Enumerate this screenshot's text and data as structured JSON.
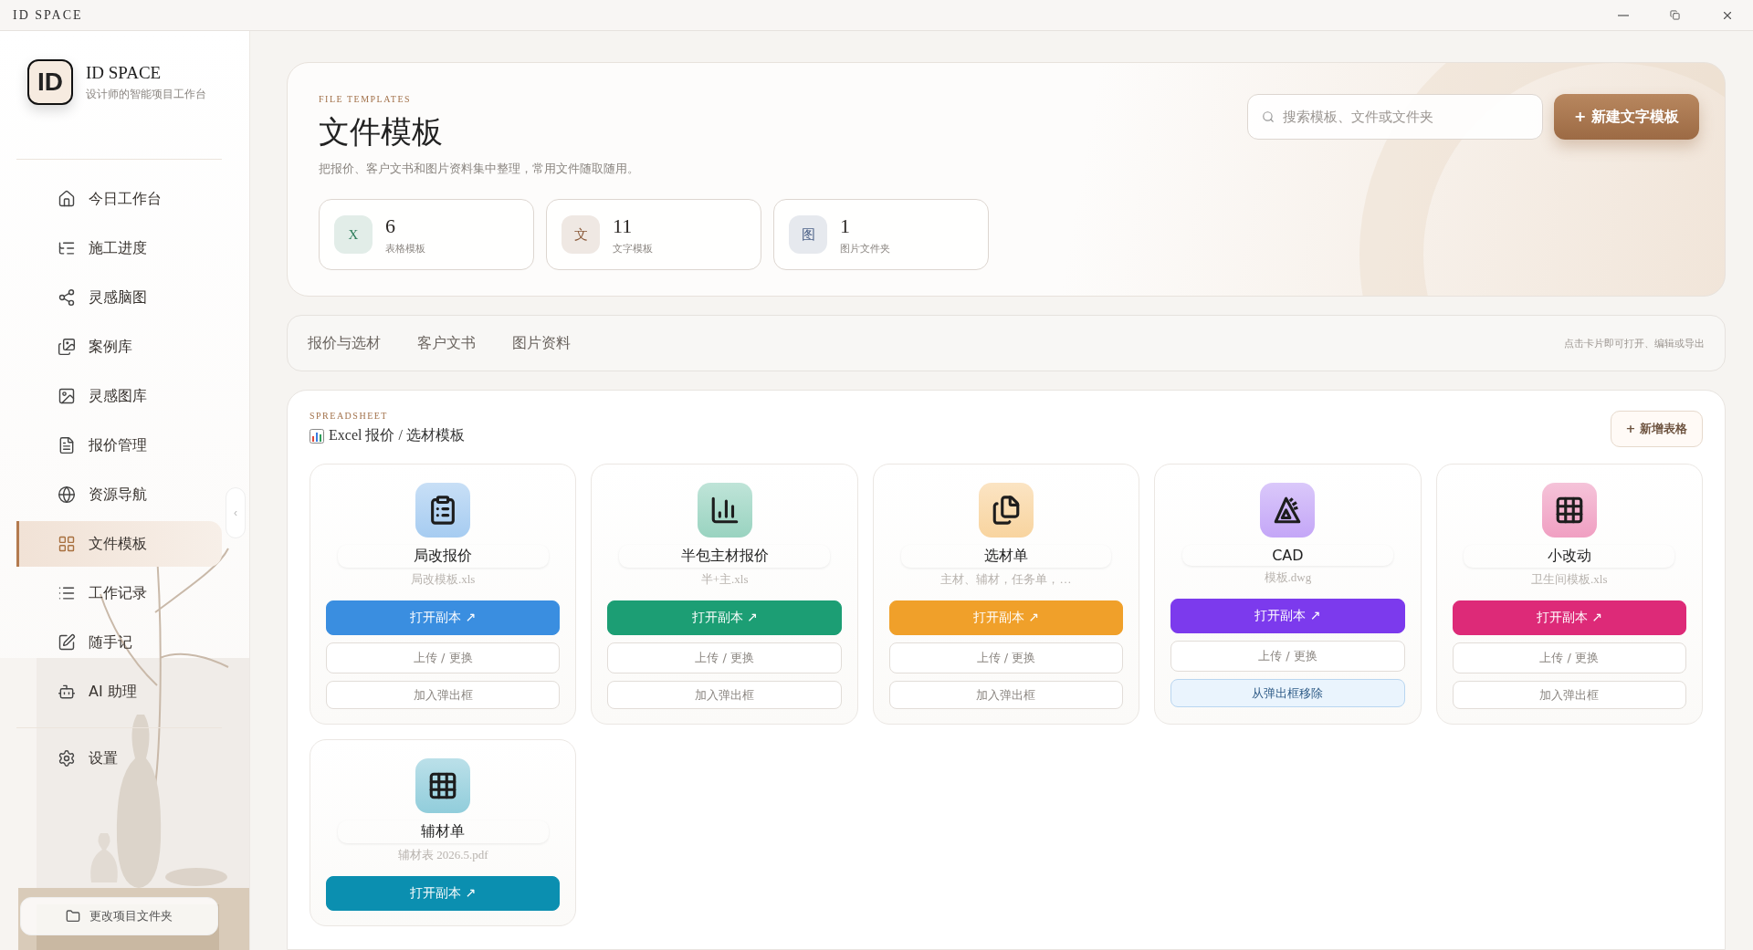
{
  "window": {
    "title": "ID SPACE"
  },
  "sidebar": {
    "brand": {
      "logo": "ID",
      "name": "ID SPACE",
      "tagline": "设计师的智能项目工作台"
    },
    "items": [
      {
        "label": "今日工作台",
        "selected": false
      },
      {
        "label": "施工进度",
        "selected": false
      },
      {
        "label": "灵感脑图",
        "selected": false
      },
      {
        "label": "案例库",
        "selected": false
      },
      {
        "label": "灵感图库",
        "selected": false
      },
      {
        "label": "报价管理",
        "selected": false
      },
      {
        "label": "资源导航",
        "selected": false
      },
      {
        "label": "文件模板",
        "selected": true
      },
      {
        "label": "工作记录",
        "selected": false
      },
      {
        "label": "随手记",
        "selected": false
      },
      {
        "label": "AI 助理",
        "selected": false
      }
    ],
    "settings": "设置",
    "collapse": "‹",
    "footer_button": "更改项目文件夹"
  },
  "header": {
    "eyebrow": "FILE TEMPLATES",
    "title": "文件模板",
    "subtitle": "把报价、客户文书和图片资料集中整理，常用文件随取随用。",
    "search": {
      "placeholder": "搜索模板、文件或文件夹"
    },
    "new_button": "+ 新建文字模板",
    "stats": [
      {
        "badge": "X",
        "value": "6",
        "label": "表格模板",
        "color": "#2e7d5b"
      },
      {
        "badge": "文",
        "value": "11",
        "label": "文字模板",
        "color": "#8a5a3a"
      },
      {
        "badge": "图",
        "value": "1",
        "label": "图片文件夹",
        "color": "#4a5f86"
      }
    ]
  },
  "tabs": {
    "items": [
      {
        "label": "报价与选材"
      },
      {
        "label": "客户文书"
      },
      {
        "label": "图片资料"
      }
    ],
    "hint": "点击卡片即可打开、编辑或导出"
  },
  "section": {
    "eyebrow": "SPREADSHEET",
    "title": "Excel 报价 / 选材模板",
    "add_button": "+ 新增表格",
    "cards": [
      {
        "name": "局改报价",
        "file": "局改模板.xls",
        "color": "#3a8ee0",
        "actions": [
          {
            "kind": "open",
            "label": "打开副本 ↗"
          },
          {
            "kind": "upload",
            "label": "上传 / 更换"
          },
          {
            "kind": "add",
            "label": "加入弹出框"
          }
        ]
      },
      {
        "name": "半包主材报价",
        "file": "半+主.xls",
        "color": "#1c9e74",
        "actions": [
          {
            "kind": "open",
            "label": "打开副本 ↗"
          },
          {
            "kind": "upload",
            "label": "上传 / 更换"
          },
          {
            "kind": "add",
            "label": "加入弹出框"
          }
        ]
      },
      {
        "name": "选材单",
        "file": "主材、辅材，任务单，…",
        "color": "#f0a02a",
        "actions": [
          {
            "kind": "open",
            "label": "打开副本 ↗"
          },
          {
            "kind": "upload",
            "label": "上传 / 更换"
          },
          {
            "kind": "add",
            "label": "加入弹出框"
          }
        ]
      },
      {
        "name": "CAD",
        "file": "模板.dwg",
        "color": "#7c3aed",
        "actions": [
          {
            "kind": "open",
            "label": "打开副本 ↗"
          },
          {
            "kind": "upload",
            "label": "上传 / 更换"
          },
          {
            "kind": "remove",
            "label": "从弹出框移除"
          }
        ]
      },
      {
        "name": "小改动",
        "file": "卫生间模板.xls",
        "color": "#dd2a78",
        "actions": [
          {
            "kind": "open",
            "label": "打开副本 ↗"
          },
          {
            "kind": "upload",
            "label": "上传 / 更换"
          },
          {
            "kind": "add",
            "label": "加入弹出框"
          }
        ]
      },
      {
        "name": "辅材单",
        "file": "辅材表 2026.5.pdf",
        "color": "#0b8fb0",
        "actions": [
          {
            "kind": "open",
            "label": "打开副本 ↗"
          }
        ]
      }
    ]
  }
}
